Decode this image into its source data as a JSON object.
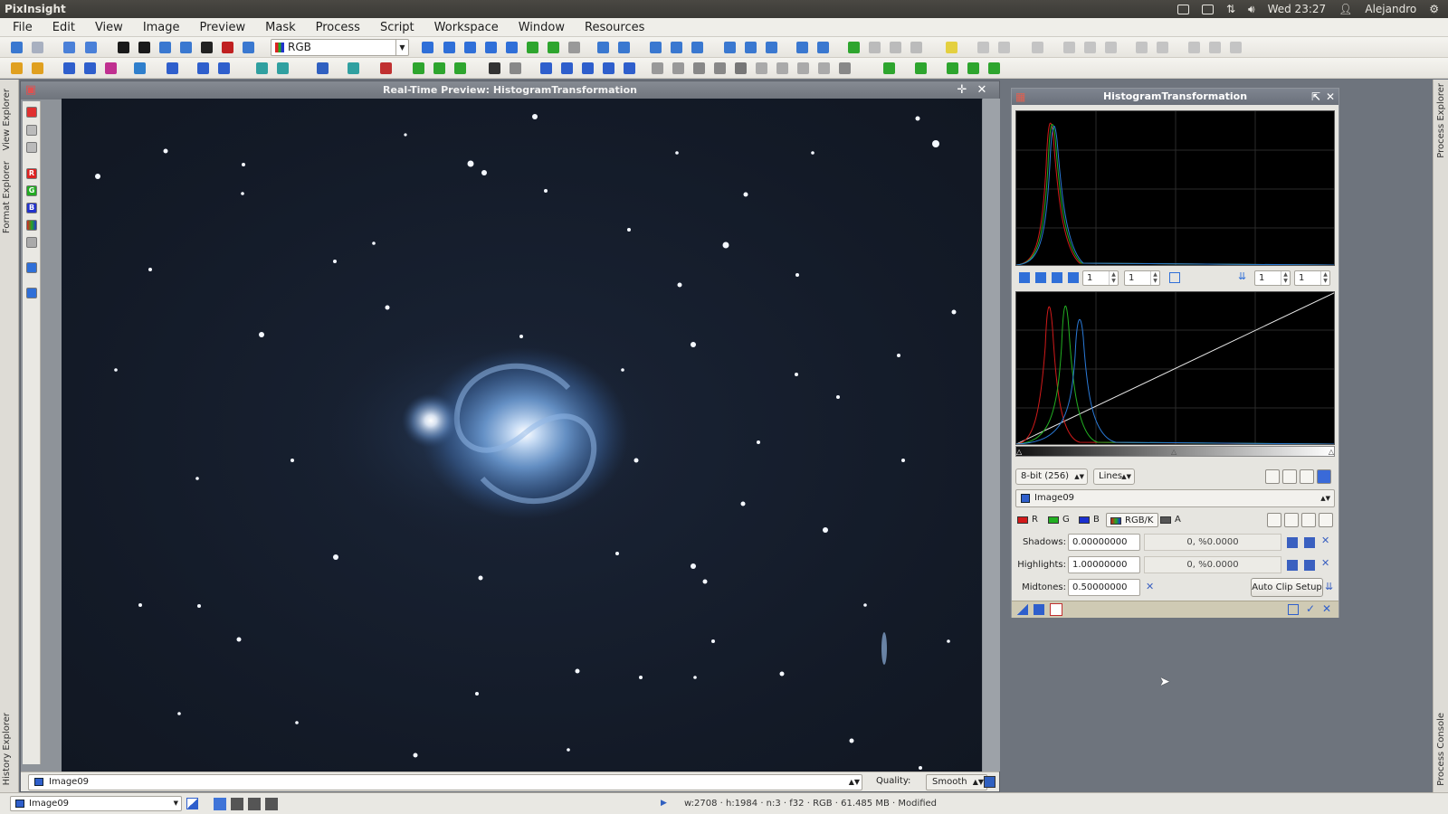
{
  "os_panel": {
    "app_title": "PixInsight",
    "clock": "Wed 23:27",
    "user": "Alejandro"
  },
  "menubar": {
    "items": [
      "File",
      "Edit",
      "View",
      "Image",
      "Preview",
      "Mask",
      "Process",
      "Script",
      "Workspace",
      "Window",
      "Resources"
    ]
  },
  "toolbar": {
    "color_space": "RGB"
  },
  "docks": {
    "left": [
      "View Explorer",
      "Format Explorer",
      "History Explorer"
    ],
    "right": [
      "Process Explorer",
      "Process Console"
    ]
  },
  "image_window": {
    "title": "Real-Time Preview: HistogramTransformation",
    "view_name": "Image09",
    "quality_label": "Quality:",
    "quality_value": "Smooth"
  },
  "histogram_panel": {
    "title": "HistogramTransformation",
    "zoom_h": "1",
    "zoom_v": "1",
    "zoom_h2": "1",
    "zoom_v2": "1",
    "resolution": "8-bit (256)",
    "graph_style": "Lines",
    "target_view": "Image09",
    "channels": [
      {
        "label": "R",
        "color": "#d21a1a"
      },
      {
        "label": "G",
        "color": "#22b022"
      },
      {
        "label": "B",
        "color": "#1a2fd0"
      },
      {
        "label": "RGB/K",
        "color": "#888888"
      },
      {
        "label": "A",
        "color": "#555555"
      }
    ],
    "shadows_label": "Shadows:",
    "shadows_value": "0.00000000",
    "shadows_readout": "0, %0.0000",
    "highlights_label": "Highlights:",
    "highlights_value": "1.00000000",
    "highlights_readout": "0, %0.0000",
    "midtones_label": "Midtones:",
    "midtones_value": "0.50000000",
    "auto_clip_label": "Auto Clip Setup"
  },
  "statusbar": {
    "window_name": "Image09",
    "image_info": "w:2708 · h:1984 · n:3 · f32 · RGB · 61.485 MB · Modified"
  },
  "colors": {
    "workspace": "#6e747d",
    "panel_title": "#6a707a",
    "sky": "#131a27",
    "galaxy": "#6f9fd8"
  }
}
